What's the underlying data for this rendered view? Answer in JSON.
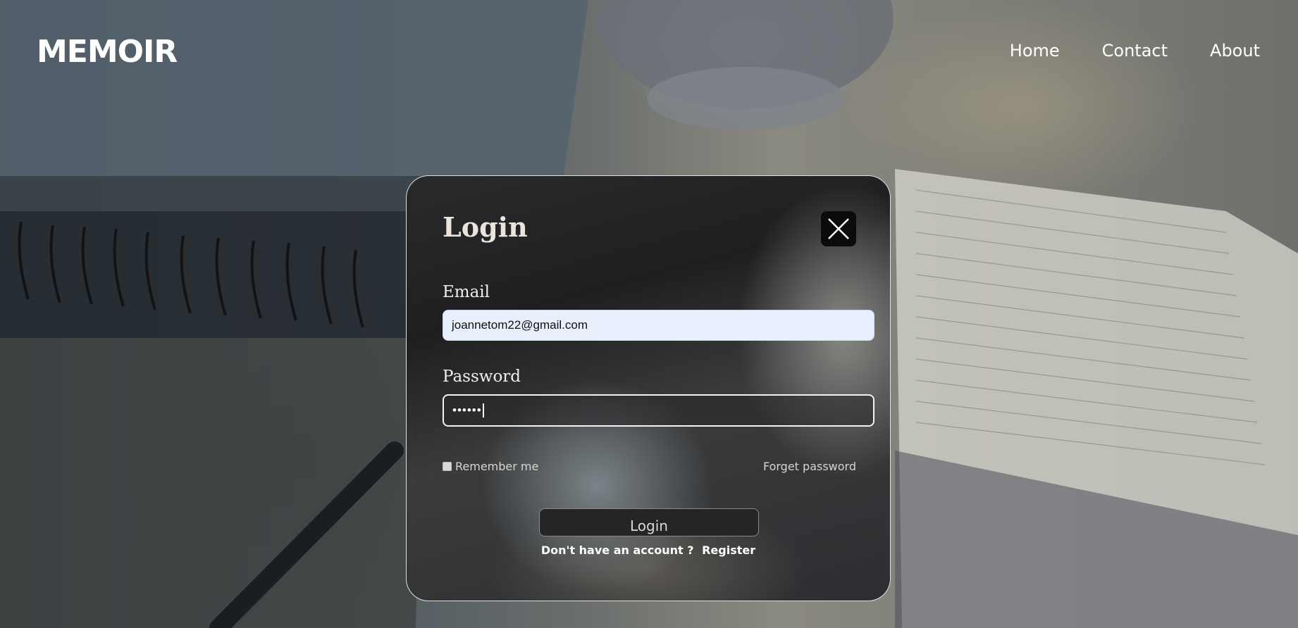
{
  "brand": "MEMOIR",
  "nav": {
    "home": "Home",
    "contact": "Contact",
    "about": "About"
  },
  "modal": {
    "title": "Login",
    "close_icon": "close-icon",
    "email_label": "Email",
    "email_value": "joannetom22@gmail.com",
    "password_label": "Password",
    "password_value": "••••••",
    "remember_label": "Remember me",
    "remember_checked": false,
    "forget_label": "Forget password",
    "login_button": "Login",
    "no_account_text": "Don't have an account ?",
    "register_label": "Register"
  },
  "colors": {
    "modal_border": "#ffffff",
    "email_field_bg": "#e8effd",
    "close_button_bg": "#0b0b0d"
  }
}
